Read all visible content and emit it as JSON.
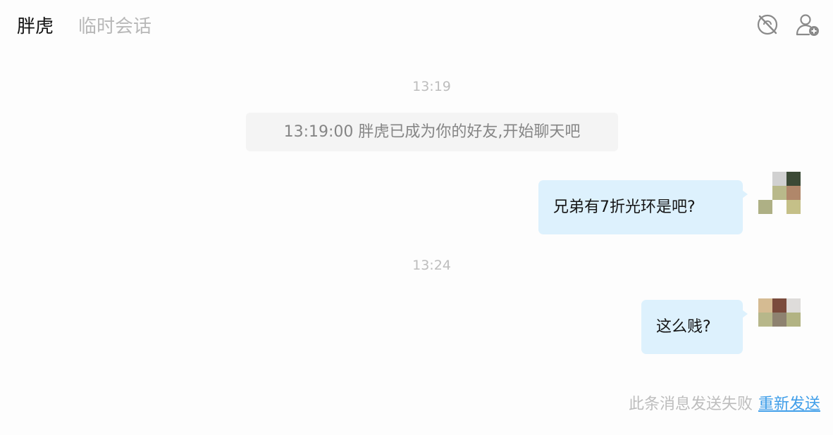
{
  "header": {
    "contact_name": "胖虎",
    "session_type": "临时会话",
    "mute_icon": "mute-icon",
    "add_friend_icon": "add-user-icon"
  },
  "messages": [
    {
      "timestamp": "13:19"
    },
    {
      "system_notice": "13:19:00 胖虎已成为你的好友,开始聊天吧"
    },
    {
      "text": "兄弟有7折光环是吧?"
    },
    {
      "timestamp": "13:24"
    },
    {
      "text": "这么贱?"
    }
  ],
  "failure": {
    "text": "此条消息发送失败",
    "resend_label": "重新发送"
  },
  "colors": {
    "bubble": "#ddf1fd",
    "link": "#3f9ee9",
    "muted_text": "#bdbdbd"
  },
  "avatars": [
    [
      "#fdfdfd",
      "#d1d1d1",
      "#3c4a36",
      "#fdfdfd",
      "#b9b98a",
      "#b0876a",
      "#aeb085",
      "#fdfdfd",
      "#c5c088"
    ],
    [
      "#d5bb92",
      "#7a4b3c",
      "#dedcda",
      "#b7b78a",
      "#8e8270",
      "#b2b383",
      "#fdfdfd",
      "#fdfdfd",
      "#fdfdfd"
    ]
  ]
}
